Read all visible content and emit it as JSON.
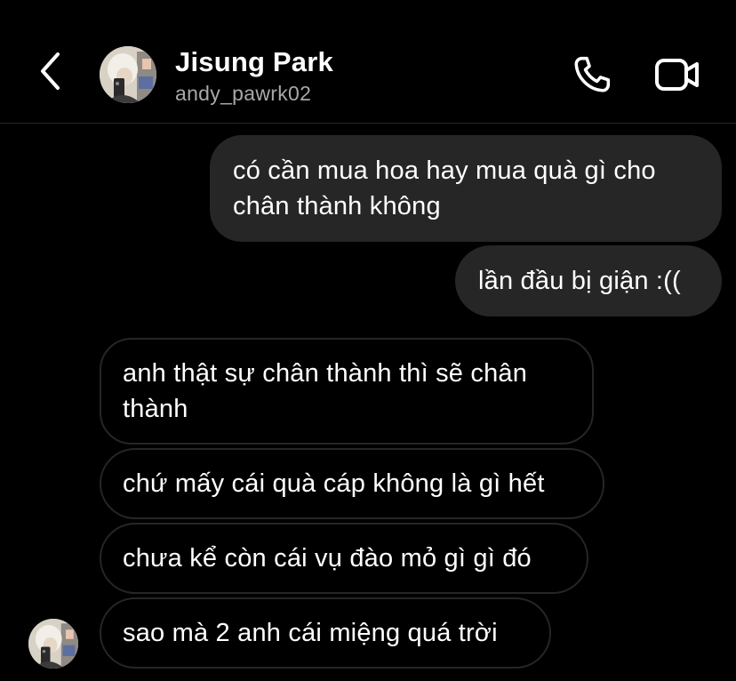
{
  "header": {
    "name": "Jisung Park",
    "handle": "andy_pawrk02",
    "back_icon": "chevron-left-icon",
    "call_icon": "phone-icon",
    "video_icon": "video-camera-icon"
  },
  "messages": [
    {
      "direction": "sent",
      "text": "có cần mua hoa hay mua quà gì cho chân thành không"
    },
    {
      "direction": "sent",
      "text": "lần đầu bị giận :(("
    },
    {
      "direction": "received",
      "text": "anh thật sự chân thành thì sẽ chân thành"
    },
    {
      "direction": "received",
      "text": "chứ mấy cái quà cáp không là gì hết"
    },
    {
      "direction": "received",
      "text": "chưa kể còn cái vụ đào mỏ gì gì đó"
    },
    {
      "direction": "received",
      "text": "sao mà 2 anh cái miệng quá trời"
    }
  ],
  "colors": {
    "background": "#000000",
    "sent_bubble": "#262626",
    "received_border": "#262626",
    "text": "#ffffff",
    "secondary_text": "#a8a8a8"
  }
}
